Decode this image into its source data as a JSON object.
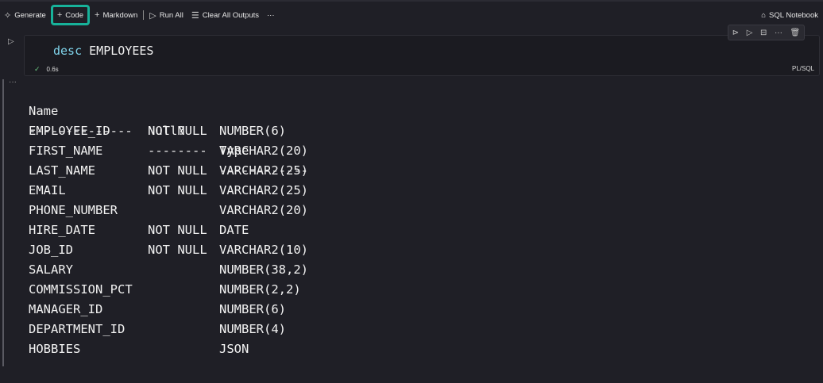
{
  "toolbar": {
    "generate_label": "Generate",
    "code_label": "Code",
    "markdown_label": "Markdown",
    "run_all_label": "Run All",
    "clear_outputs_label": "Clear All Outputs",
    "more_label": "···",
    "kernel_label": "SQL Notebook"
  },
  "icons": {
    "generate": "sparkle-icon",
    "code": "plus-icon",
    "markdown": "plus-icon",
    "run_all": "run-all-icon",
    "clear_outputs": "clear-list-icon",
    "kernel": "notebook-kernel-icon",
    "cell_run": "run-cell-icon",
    "cell_tools": [
      "run-above-icon",
      "run-below-icon",
      "split-cell-icon",
      "more-icon",
      "delete-icon"
    ]
  },
  "cell": {
    "keyword": "desc",
    "target": "EMPLOYEES",
    "duration": "0.6s",
    "language": "PL/SQL",
    "tools_more": "···",
    "output_more": "···"
  },
  "colors": {
    "accent": "#17b29a",
    "keyword": "#7fd3ea",
    "success": "#6ccb83",
    "background": "#1f1f26"
  },
  "output": {
    "headers": [
      "Name",
      "Null?",
      "Type"
    ],
    "underline": [
      "--------------",
      "--------",
      "------------"
    ],
    "rows": [
      [
        "EMPLOYEE_ID",
        "NOT NULL",
        "NUMBER(6)"
      ],
      [
        "FIRST_NAME",
        "",
        "VARCHAR2(20)"
      ],
      [
        "LAST_NAME",
        "NOT NULL",
        "VARCHAR2(25)"
      ],
      [
        "EMAIL",
        "NOT NULL",
        "VARCHAR2(25)"
      ],
      [
        "PHONE_NUMBER",
        "",
        "VARCHAR2(20)"
      ],
      [
        "HIRE_DATE",
        "NOT NULL",
        "DATE"
      ],
      [
        "JOB_ID",
        "NOT NULL",
        "VARCHAR2(10)"
      ],
      [
        "SALARY",
        "",
        "NUMBER(38,2)"
      ],
      [
        "COMMISSION_PCT",
        "",
        "NUMBER(2,2)"
      ],
      [
        "MANAGER_ID",
        "",
        "NUMBER(6)"
      ],
      [
        "DEPARTMENT_ID",
        "",
        "NUMBER(4)"
      ],
      [
        "HOBBIES",
        "",
        "JSON"
      ]
    ]
  }
}
